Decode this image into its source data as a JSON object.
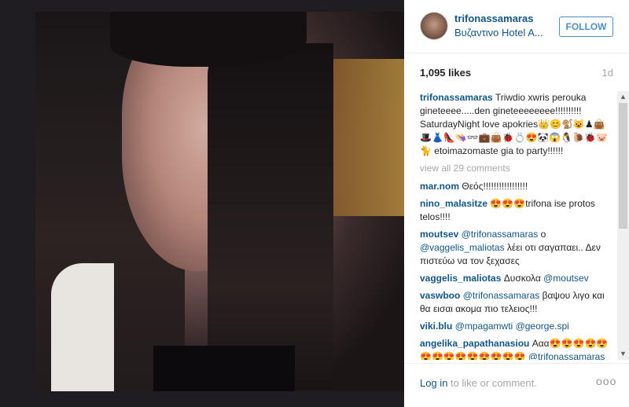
{
  "post": {
    "username": "trifonassamaras",
    "location": "Βυζαντινο Hotel A...",
    "follow_label": "FOLLOW",
    "likes": "1,095 likes",
    "age": "1d"
  },
  "caption": {
    "user": "trifonassamaras",
    "text": "Triwdio xwris perouka gineteeee.....den gineteeeeeeee!!!!!!!!!! SaturdayNight love apokries👑😊🐒😺♟👜🎩👗👠👒👓💼👜🐞💍😍🐼😱🐧🐌🐞🐷🐈 etoimazomaste gia to party!!!!!!"
  },
  "view_all": "view all 29 comments",
  "comments": [
    {
      "user": "mar.nom",
      "parts": [
        {
          "t": "Θεός!!!!!!!!!!!!!!!!!",
          "m": false
        }
      ]
    },
    {
      "user": "nino_malasitze",
      "parts": [
        {
          "t": "😍😍😍trifona ise protos telos!!!!",
          "m": false
        }
      ]
    },
    {
      "user": "moutsev",
      "parts": [
        {
          "t": "@trifonassamaras",
          "m": true
        },
        {
          "t": " ο ",
          "m": false
        },
        {
          "t": "@vaggelis_maliotas",
          "m": true
        },
        {
          "t": " λέει οτι σαγαπαει.. Δεν πιστεύω να τον ξεχασες",
          "m": false
        }
      ]
    },
    {
      "user": "vaggelis_maliotas",
      "parts": [
        {
          "t": "Δυσκολα ",
          "m": false
        },
        {
          "t": "@moutsev",
          "m": true
        }
      ]
    },
    {
      "user": "vaswboo",
      "parts": [
        {
          "t": "@trifonassamaras",
          "m": true
        },
        {
          "t": " βαψου λιγο και θα εισαι ακομα πιο τελειος!!!",
          "m": false
        }
      ]
    },
    {
      "user": "viki.blu",
      "parts": [
        {
          "t": "@mpagamwti",
          "m": true
        },
        {
          "t": " ",
          "m": false
        },
        {
          "t": "@george.spi",
          "m": true
        }
      ]
    },
    {
      "user": "angelika_papathanasiou",
      "parts": [
        {
          "t": "Ααα😍😍😍😍😍😍😍😍😍😍😍😍😍😍 ",
          "m": false
        },
        {
          "t": "@trifonassamaras",
          "m": true
        }
      ]
    }
  ],
  "footer": {
    "login_link": "Log in",
    "login_text": " to like or comment.",
    "more": "ooo"
  },
  "icons": {
    "scroll_up": "▲",
    "scroll_down": "▼"
  }
}
